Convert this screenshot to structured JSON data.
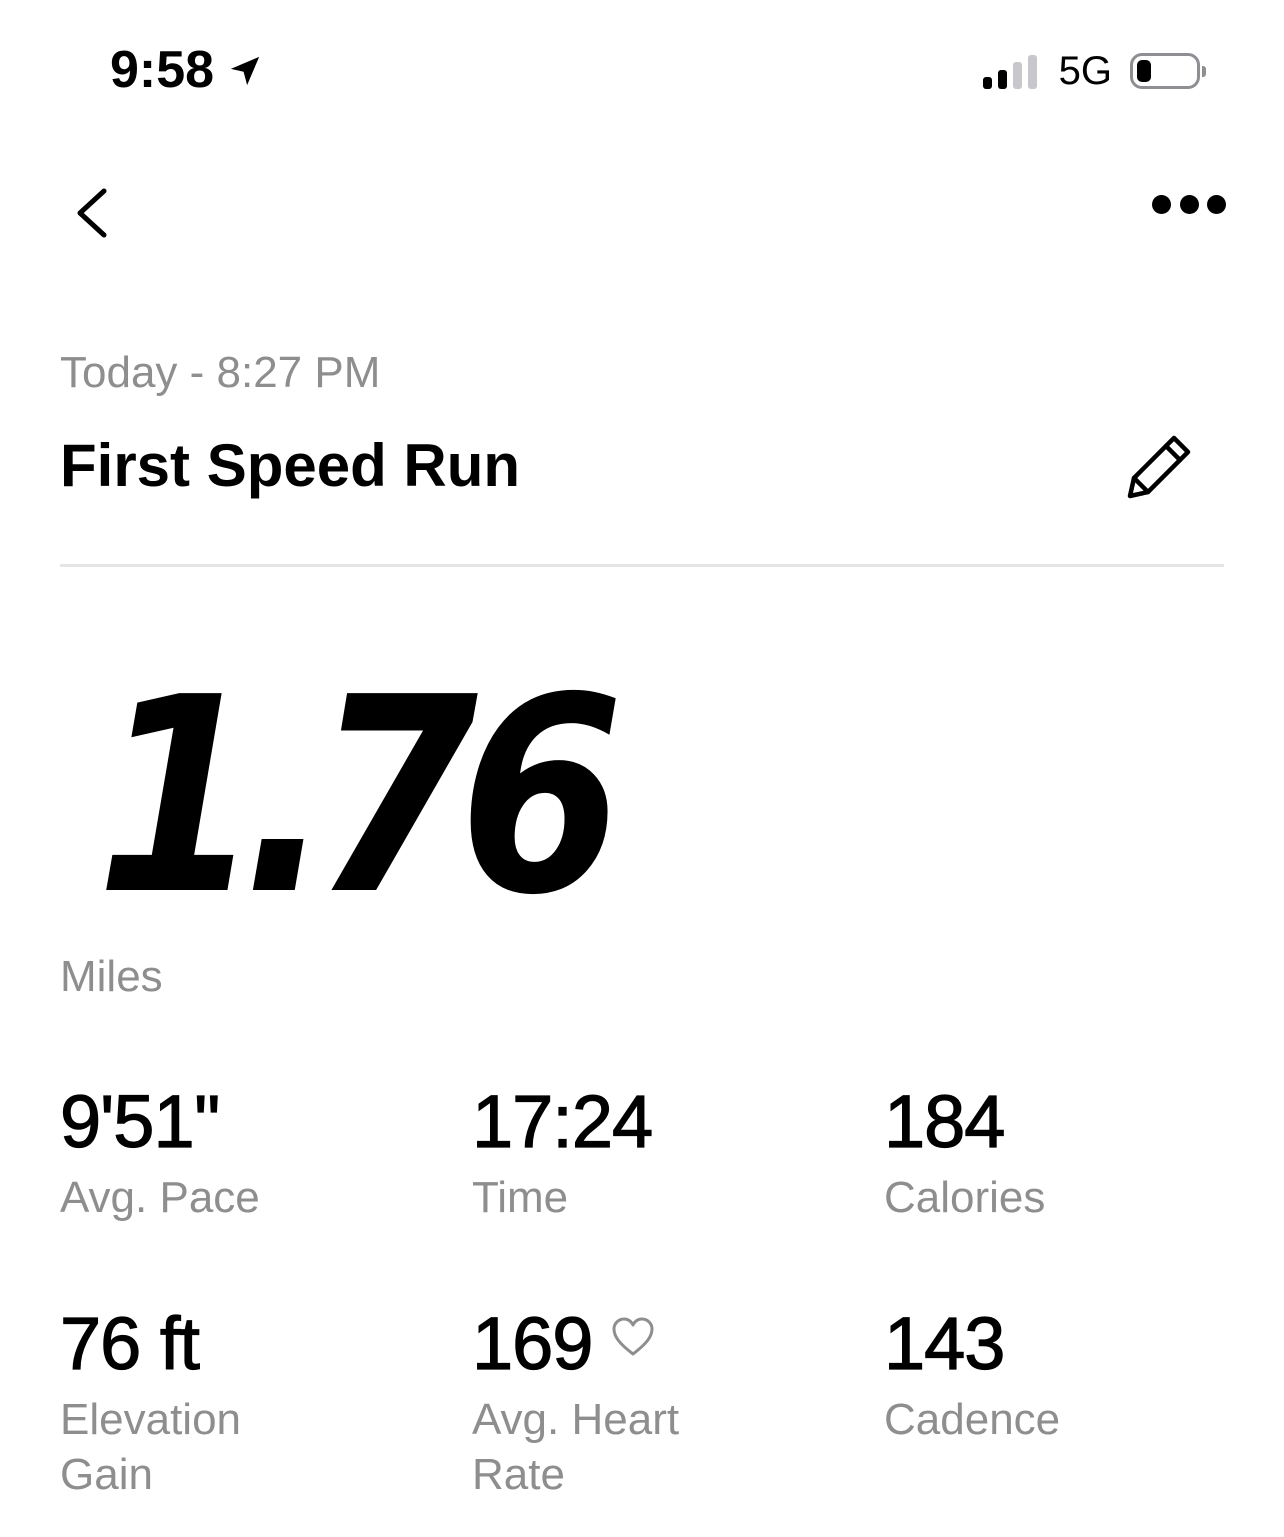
{
  "status_bar": {
    "time": "9:58",
    "network": "5G",
    "signal_bars": 2,
    "signal_total": 4,
    "battery_level": 0.25
  },
  "nav": {
    "back_icon": "chevron-left-icon",
    "more_icon": "ellipsis-icon"
  },
  "activity": {
    "date": "Today - 8:27 PM",
    "title": "First Speed Run",
    "edit_icon": "pencil-icon",
    "distance": "1.76",
    "distance_unit": "Miles"
  },
  "stats": [
    {
      "value": "9'51''",
      "label": "Avg. Pace"
    },
    {
      "value": "17:24",
      "label": "Time"
    },
    {
      "value": "184",
      "label": "Calories"
    },
    {
      "value": "76 ft",
      "label": "Elevation Gain"
    },
    {
      "value": "169",
      "label": "Avg. Heart Rate",
      "icon": "heart-outline-icon"
    },
    {
      "value": "143",
      "label": "Cadence"
    }
  ],
  "colors": {
    "primary_text": "#000000",
    "secondary_text": "#8e8e8e",
    "divider": "#e5e5e5",
    "inactive_signal": "#c7c7cc"
  }
}
